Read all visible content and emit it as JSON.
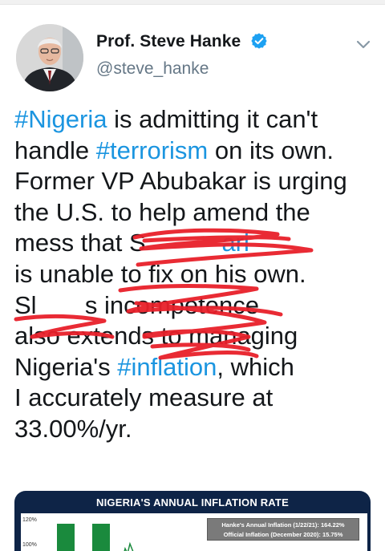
{
  "tweet": {
    "author": {
      "display_name": "Prof. Steve Hanke",
      "handle": "@steve_hanke",
      "verified": true,
      "avatar_icon": "profile-photo"
    },
    "menu_icon": "chevron-down-icon",
    "text_lines": [
      [
        {
          "t": "#Nigeria",
          "tag": true
        },
        {
          "t": " is admitting it can't",
          "tag": false
        }
      ],
      [
        {
          "t": "handle ",
          "tag": false
        },
        {
          "t": "#terrorism",
          "tag": true
        },
        {
          "t": " on its own.",
          "tag": false
        }
      ],
      [
        {
          "t": "Former VP Abubakar is urging",
          "tag": false
        }
      ],
      [
        {
          "t": "the U.S. to help amend the",
          "tag": false
        }
      ],
      [
        {
          "t": "mess that S",
          "tag": false
        },
        {
          "t": "           ",
          "tag": false
        },
        {
          "t": "ari",
          "tag": true
        }
      ],
      [
        {
          "t": "is unable to fix on his own.",
          "tag": false
        }
      ],
      [
        {
          "t": "Sl",
          "tag": false
        },
        {
          "t": "       ",
          "tag": false
        },
        {
          "t": "s incompetence",
          "tag": false
        }
      ],
      [
        {
          "t": "also extends to managing",
          "tag": false
        }
      ],
      [
        {
          "t": "Nigeria's ",
          "tag": false
        },
        {
          "t": "#inflation",
          "tag": true
        },
        {
          "t": ", which",
          "tag": false
        }
      ],
      [
        {
          "t": "I accurately measure at",
          "tag": false
        }
      ],
      [
        {
          "t": "33.00%/yr.",
          "tag": false
        }
      ]
    ],
    "colors": {
      "hashtag": "#1b95e0",
      "text": "#14171a",
      "handle": "#657786",
      "redaction": "#e8202a",
      "chart_header": "#0e2447",
      "verified": "#1da1f2"
    }
  },
  "media": {
    "chart_title": "NIGERIA'S ANNUAL INFLATION RATE",
    "legend": [
      "Hanke's Annual Inflation (1/22/21): 164.22%",
      "Official Inflation (December 2020): 15.75%"
    ],
    "y_ticks": [
      "120%",
      "100%"
    ]
  }
}
